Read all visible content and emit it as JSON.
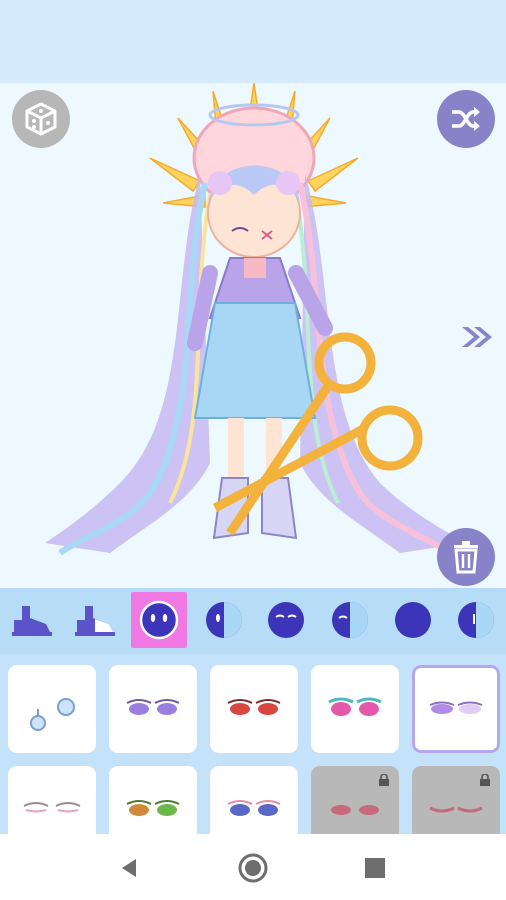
{
  "app": {
    "accent": "#8883c8",
    "highlight": "#f078e2",
    "panel_bg": "#b7dcf8"
  },
  "stage": {
    "top_left_button": "dice-icon",
    "top_right_button": "shuffle-icon",
    "bottom_right_button": "trash-icon",
    "side_arrow": "double-chevron-right-icon"
  },
  "category_tabs": [
    {
      "icon": "shoe-icon"
    },
    {
      "icon": "shoe-alt-icon"
    },
    {
      "icon": "face-icon",
      "selected": true
    },
    {
      "icon": "half-face-icon"
    },
    {
      "icon": "face-eyes-icon"
    },
    {
      "icon": "half-face-alt-icon"
    },
    {
      "icon": "face-round-icon"
    },
    {
      "icon": "half-face-right-icon"
    }
  ],
  "items": [
    {
      "icon": "blue-charm-icon",
      "locked": false
    },
    {
      "icon": "purple-eyes-icon",
      "locked": false
    },
    {
      "icon": "red-eyes-icon",
      "locked": false
    },
    {
      "icon": "pink-eyes-icon",
      "locked": false
    },
    {
      "icon": "lilac-eyes-icon",
      "locked": false,
      "selected": true
    },
    {
      "icon": "sleepy-eyes-icon",
      "locked": false
    },
    {
      "icon": "green-eyes-icon",
      "locked": false
    },
    {
      "icon": "blue-pink-eyes-icon",
      "locked": false
    },
    {
      "icon": "rose-eyes-icon",
      "locked": true
    },
    {
      "icon": "closed-eyes-icon",
      "locked": true
    }
  ],
  "navbar": [
    "back-icon",
    "home-icon",
    "recents-icon"
  ]
}
